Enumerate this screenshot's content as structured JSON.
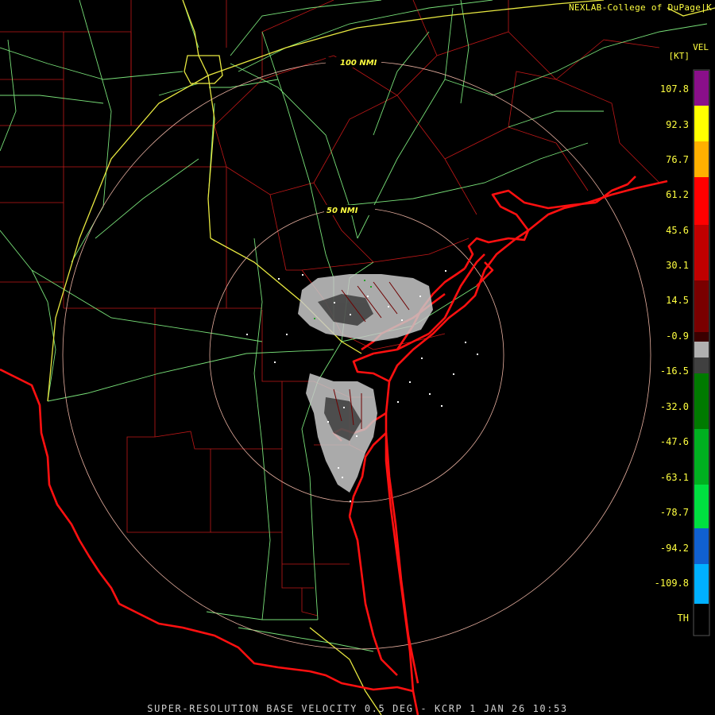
{
  "header": {
    "credit": "NEXLAB-College of DuPage|K"
  },
  "legend": {
    "product": "VEL",
    "unit": "[KT]",
    "ticks": [
      "107.8",
      "92.3",
      "76.7",
      "61.2",
      "45.6",
      "30.1",
      "14.5",
      "-0.9",
      "-16.5",
      "-32.0",
      "-47.6",
      "-63.1",
      "-78.7",
      "-94.2",
      "-109.8",
      "TH"
    ],
    "colors": {
      "purple": "#8a0f8a",
      "yellow": "#ffff00",
      "orange": "#ffb000",
      "red": "#ff0000",
      "dark_red": "#7a0000",
      "gray": "#b0b0b0",
      "dark_green": "#007a00",
      "green": "#00e040",
      "blue": "#1060d0",
      "light_blue": "#00b0ff"
    }
  },
  "rings": {
    "inner": "50 NMI",
    "outer": "100 NMI"
  },
  "footer": {
    "caption": "SUPER-RESOLUTION BASE VELOCITY 0.5 DEG - KCRP 1 JAN 26 10:53"
  },
  "map_colors": {
    "county_lines": "#c01818",
    "coastline": "#ff1010",
    "highways": "#78e078",
    "interstates": "#e8e840",
    "range_rings": "#e8b0a0"
  }
}
